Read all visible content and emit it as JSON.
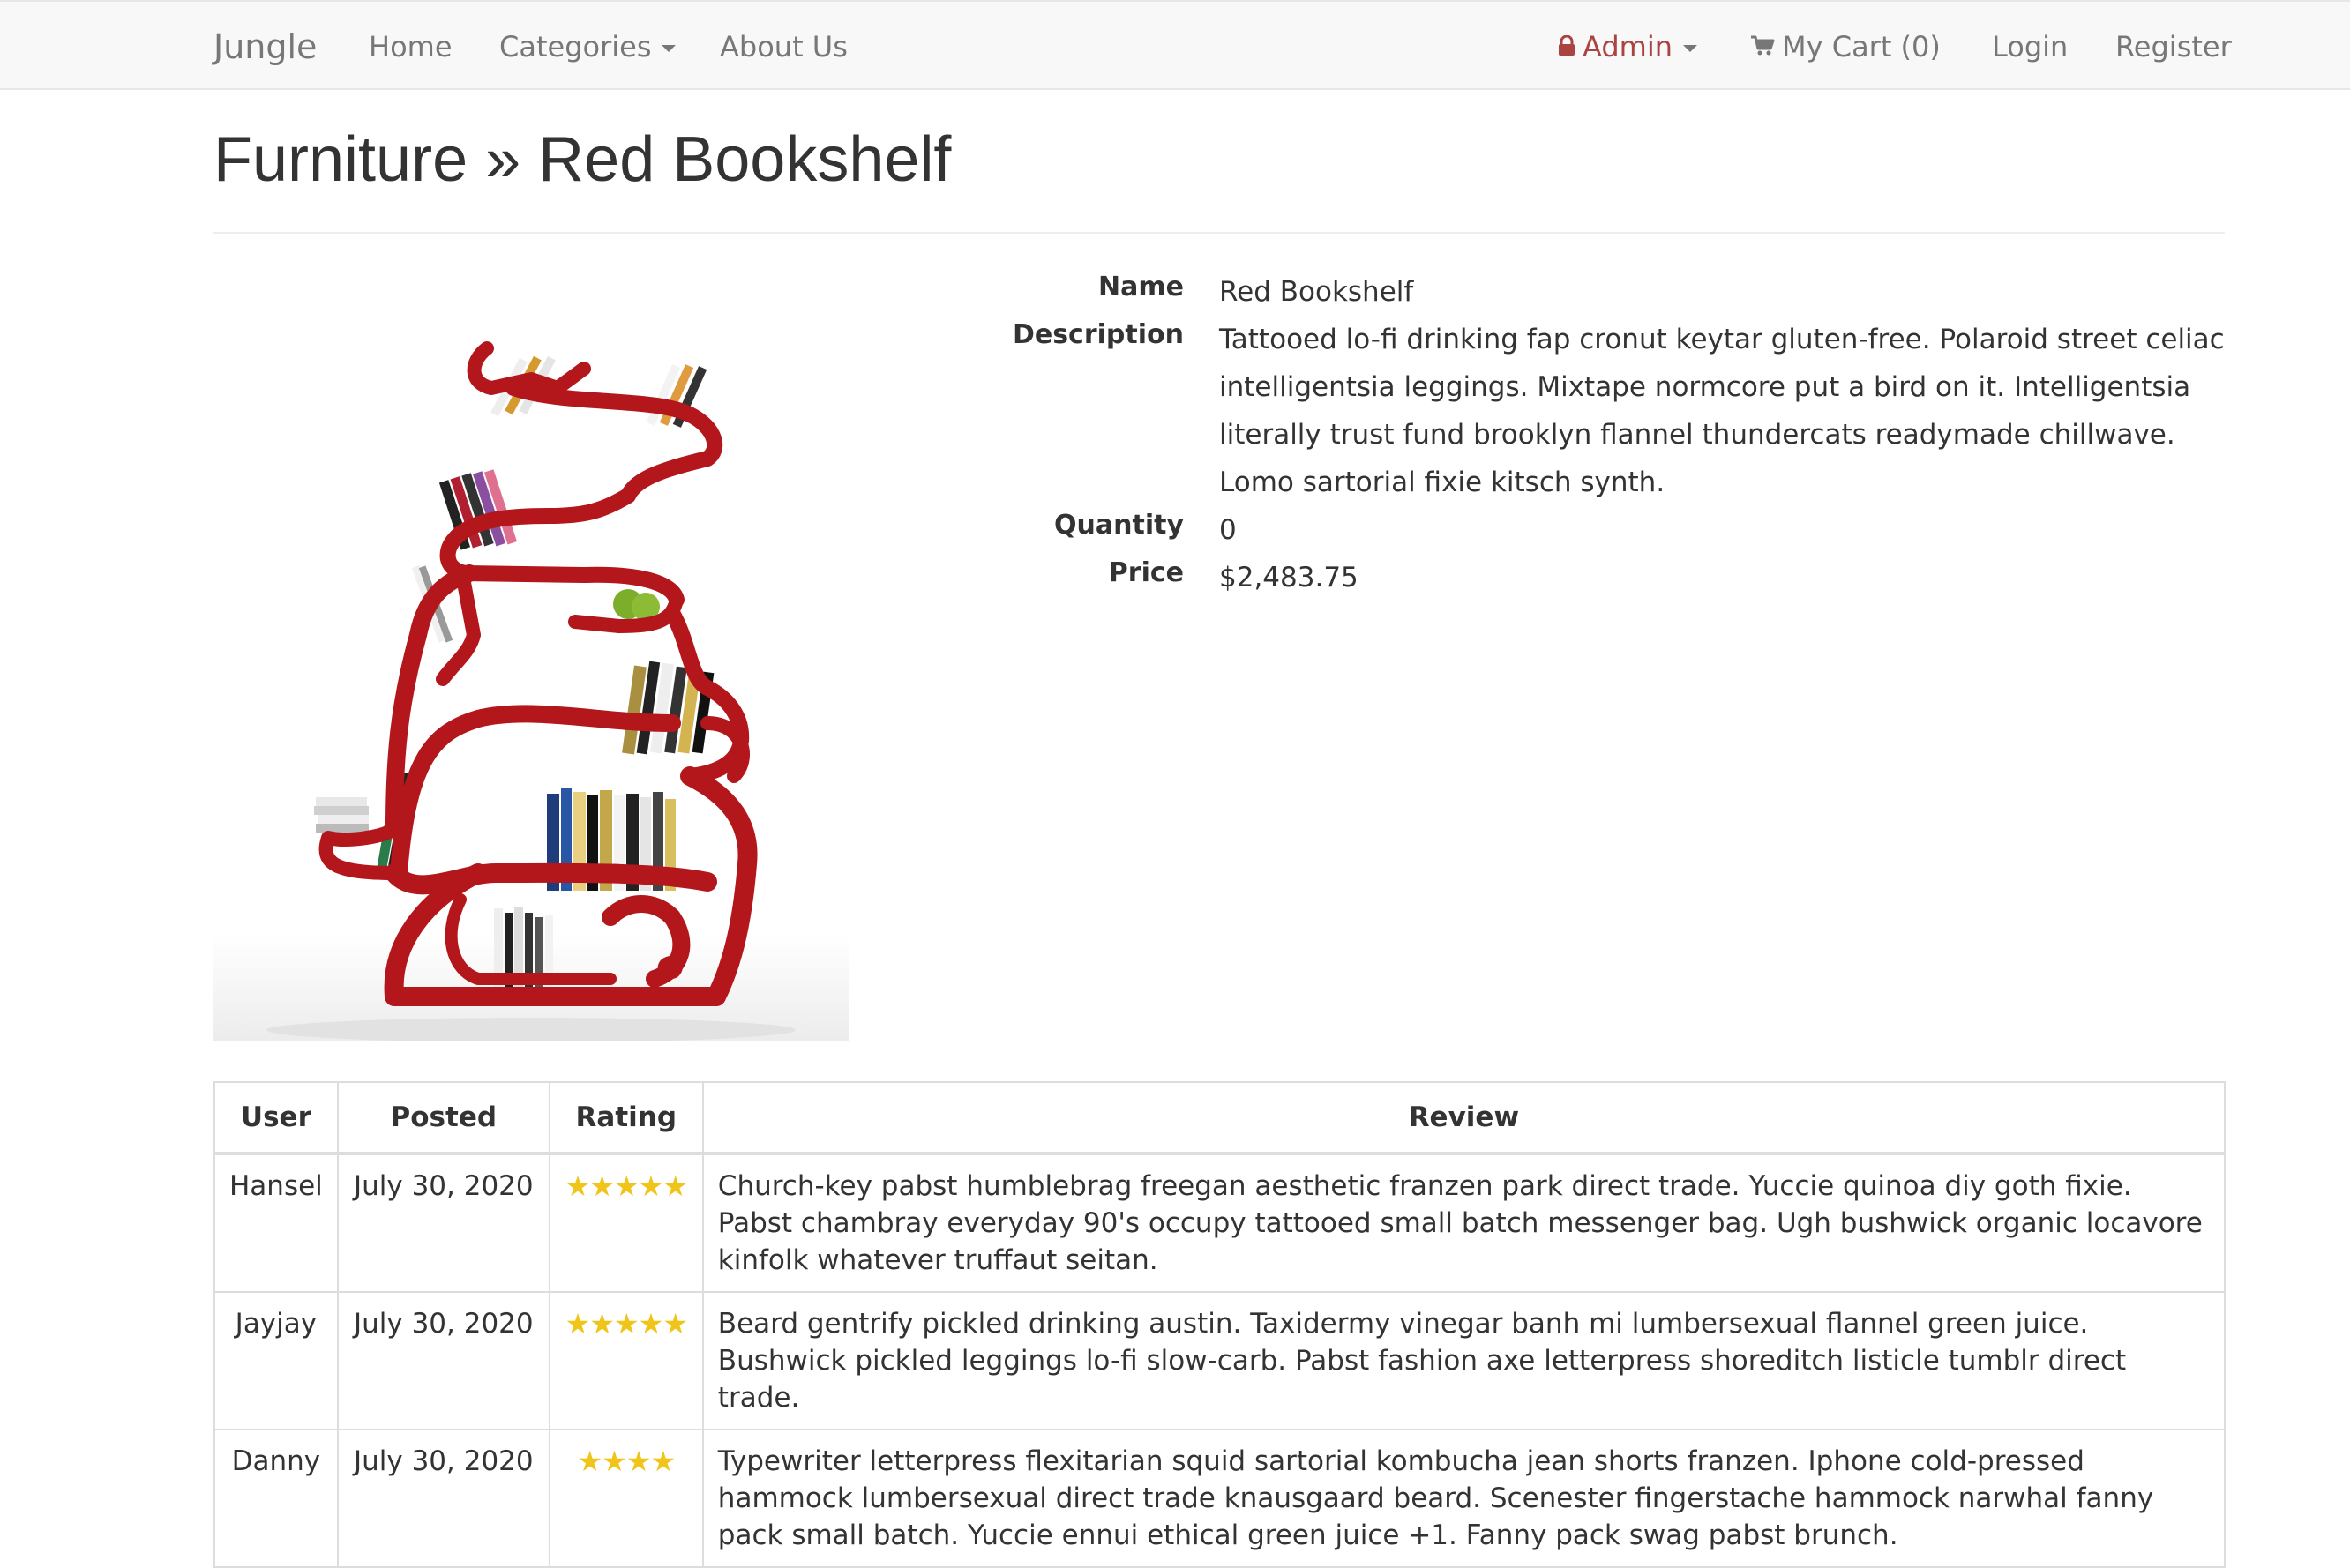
{
  "navbar": {
    "brand": "Jungle",
    "home": "Home",
    "categories": "Categories",
    "about": "About Us",
    "admin": "Admin",
    "cart": "My Cart (0)",
    "login": "Login",
    "register": "Register",
    "admin_color": "#a94442",
    "icons": [
      "lock-icon",
      "cart-icon",
      "caret-down-icon"
    ]
  },
  "page": {
    "title": "Furniture » Red Bookshelf"
  },
  "product": {
    "image_name": "red-bookshelf-image",
    "labels": {
      "name": "Name",
      "description": "Description",
      "quantity": "Quantity",
      "price": "Price"
    },
    "name": "Red Bookshelf",
    "description": "Tattooed lo-fi drinking fap cronut keytar gluten-free. Polaroid street celiac intelligentsia leggings. Mixtape normcore put a bird on it. Intelligentsia literally trust fund brooklyn flannel thundercats readymade chillwave. Lomo sartorial fixie kitsch synth.",
    "quantity": "0",
    "price": "$2,483.75"
  },
  "reviews": {
    "headers": [
      "User",
      "Posted",
      "Rating",
      "Review"
    ],
    "star_color": "#f0c419",
    "rows": [
      {
        "user": "Hansel",
        "posted": "July 30, 2020",
        "rating": 5,
        "review": "Church-key pabst humblebrag freegan aesthetic franzen park direct trade. Yuccie quinoa diy goth fixie. Pabst chambray everyday 90's occupy tattooed small batch messenger bag. Ugh bushwick organic locavore kinfolk whatever truffaut seitan."
      },
      {
        "user": "Jayjay",
        "posted": "July 30, 2020",
        "rating": 5,
        "review": "Beard gentrify pickled drinking austin. Taxidermy vinegar banh mi lumbersexual flannel green juice. Bushwick pickled leggings lo-fi slow-carb. Pabst fashion axe letterpress shoreditch listicle tumblr direct trade."
      },
      {
        "user": "Danny",
        "posted": "July 30, 2020",
        "rating": 4,
        "review": "Typewriter letterpress flexitarian squid sartorial kombucha jean shorts franzen. Iphone cold-pressed hammock lumbersexual direct trade knausgaard beard. Scenester fingerstache hammock narwhal fanny pack small batch. Yuccie ennui ethical green juice +1. Fanny pack swag pabst brunch."
      }
    ]
  }
}
